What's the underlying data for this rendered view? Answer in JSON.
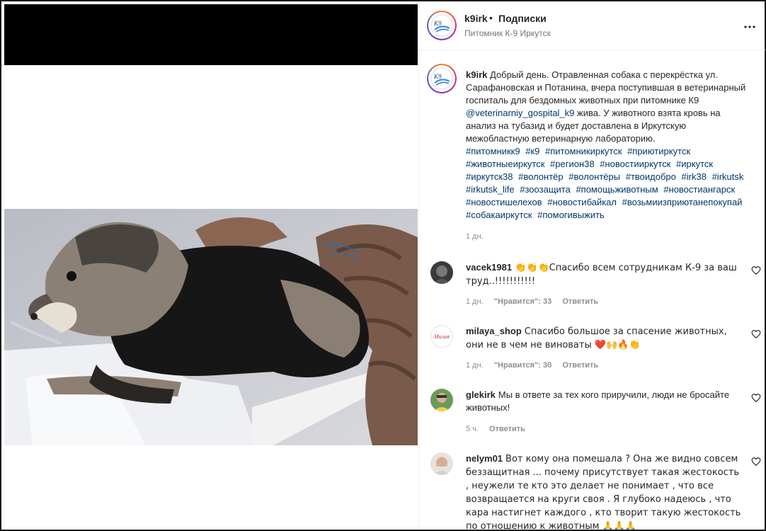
{
  "header": {
    "username": "k9irk",
    "separator": "•",
    "follow_label": "Подписки",
    "location": "Питомник К-9 Иркутск"
  },
  "post": {
    "caption_user": "k9irk",
    "caption_part1": "Добрый день. Отравленная собака с перекрёстка ул. Сарафановская и Потанина, вчера поступившая в ветеринарный госпиталь для бездомных животных при питомнике К9",
    "mention": "@veterinarniy_gospital_k9",
    "caption_part2": "жива. У животного взята кровь на анализ на тубазид и будет доставлена в Иркутскую межобластную ветеринарную лабораторию.",
    "hashtags": [
      "#питомникк9",
      "#к9",
      "#питомникиркутск",
      "#приютиркутск",
      "#животныеиркутск",
      "#регион38",
      "#новостииркутск",
      "#иркутск",
      "#иркутск38",
      "#волонтёр",
      "#волонтёры",
      "#твоидобро",
      "#irk38",
      "#irkutsk",
      "#irkutsk_life",
      "#зоозащита",
      "#помощьживотным",
      "#новостиангарск",
      "#новостишелехов",
      "#новостибайкал",
      "#возьмиизприютанепокупай",
      "#собакаиркутск",
      "#помогивыжить"
    ],
    "time": "1 дн."
  },
  "comments": [
    {
      "user": "vacek1981",
      "text": "👏👏👏Спасибо всем сотрудникам К-9 за ваш труд..!!!!!!!!!!!",
      "time": "1 дн.",
      "likes": "\"Нравится\": 33",
      "reply": "Ответить"
    },
    {
      "user": "milaya_shop",
      "text": "Спасибо большое за спасение животных, они не в чем не виноваты ❤️🙌🔥👏",
      "time": "1 дн.",
      "likes": "\"Нравится\": 30",
      "reply": "Ответить"
    },
    {
      "user": "glekirk",
      "text": "Мы в ответе за тех кого приручили, люди не бросайте животных!",
      "time": "5 ч.",
      "reply": "Ответить"
    },
    {
      "user": "nelym01",
      "text": "Вот кому она помешала ? Она же видно совсем беззащитная ... почему присутствует такая жестокость , неужели те кто это делает не понимает , что все возвращается на круги своя . Я глубоко надеюсь , что кара настигнет каждого , кто творит такую жестокость по отношению к животным 🙏🙏🙏"
    }
  ],
  "icons": {
    "more": "more-horizontal-icon",
    "like": "heart-outline-icon"
  },
  "colors": {
    "link": "#00376b",
    "muted": "#8e8e8e",
    "text": "#262626"
  }
}
